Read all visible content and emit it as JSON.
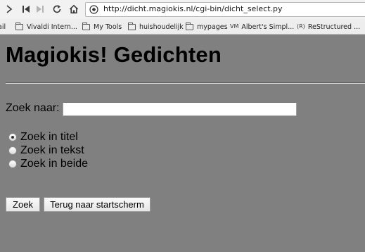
{
  "browser": {
    "url": "http://dicht.magiokis.nl/cgi-bin/dicht_select.py",
    "bookmarks": [
      {
        "label": "ail",
        "kind": "text"
      },
      {
        "label": "Vivaldi Intern...",
        "kind": "folder"
      },
      {
        "label": "My Tools",
        "kind": "folder"
      },
      {
        "label": "huishoudelijk",
        "kind": "folder"
      },
      {
        "label": "mypages",
        "kind": "folder"
      },
      {
        "label": "Albert's Simpl...",
        "kind": "site",
        "favicon": "VM"
      },
      {
        "label": "ReStructured ...",
        "kind": "site",
        "favicon": "(R)"
      }
    ]
  },
  "page": {
    "title": "Magiokis! Gedichten",
    "search_label": "Zoek naar:",
    "search_value": "",
    "radios": [
      {
        "label": "Zoek in titel",
        "checked": true
      },
      {
        "label": "Zoek in tekst",
        "checked": false
      },
      {
        "label": "Zoek in beide",
        "checked": false
      }
    ],
    "buttons": {
      "submit": "Zoek",
      "back": "Terug naar startscherm"
    }
  },
  "colors": {
    "page_background": "#808080",
    "chrome_background": "#f2f2f2"
  }
}
